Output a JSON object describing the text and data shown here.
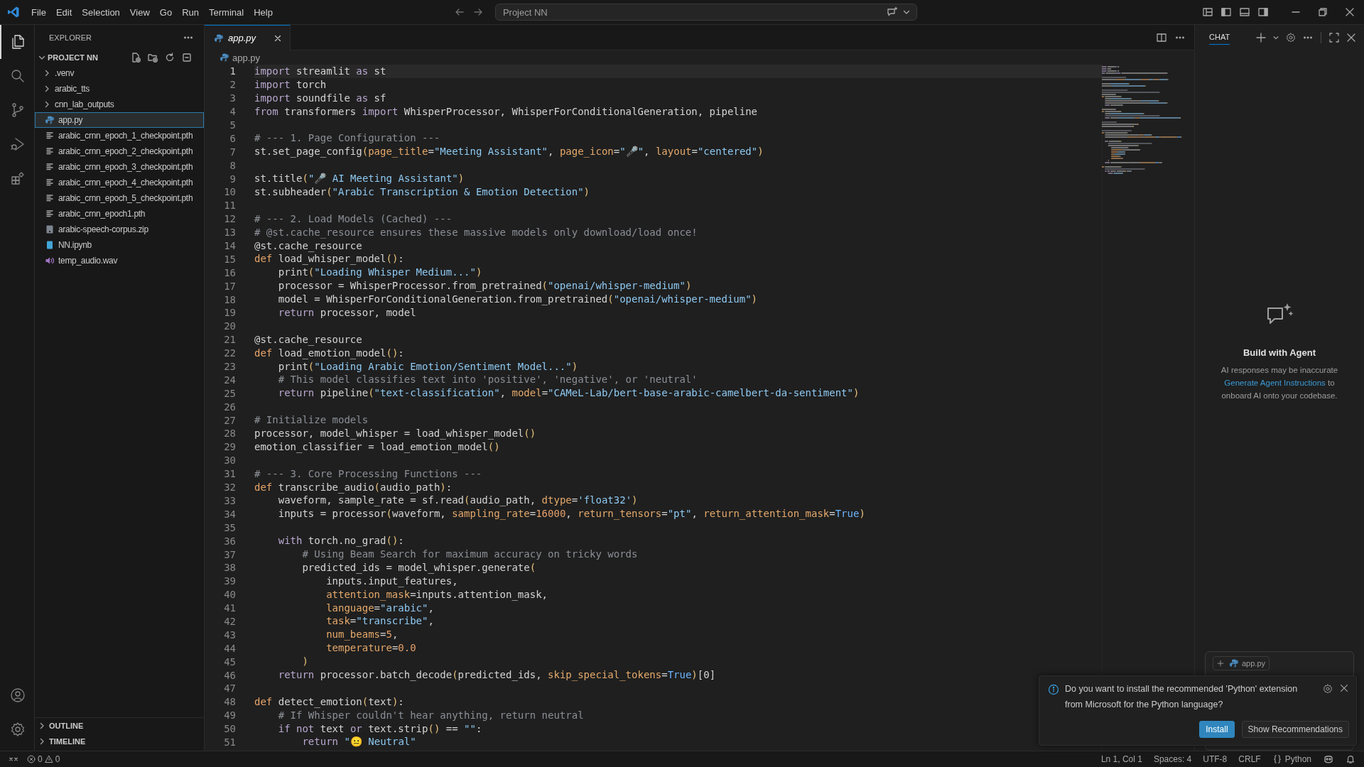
{
  "title_bar": {
    "menus": [
      "File",
      "Edit",
      "Selection",
      "View",
      "Go",
      "Run",
      "Terminal",
      "Help"
    ],
    "command_center": "Project NN"
  },
  "activity_bar": {
    "items": [
      {
        "kind": "files",
        "selected": true
      },
      {
        "kind": "search",
        "selected": false
      },
      {
        "kind": "branch",
        "selected": false
      },
      {
        "kind": "debug",
        "selected": false
      },
      {
        "kind": "extensions",
        "selected": false
      }
    ],
    "bottom": [
      {
        "kind": "account"
      },
      {
        "kind": "settings"
      }
    ]
  },
  "sidebar": {
    "title": "EXPLORER",
    "folder": {
      "label": "PROJECT NN",
      "expanded": true
    },
    "items": [
      {
        "label": ".venv",
        "kind": "folder",
        "expanded": false,
        "selected": false
      },
      {
        "label": "arabic_tts",
        "kind": "folder",
        "expanded": false,
        "selected": false
      },
      {
        "label": "cnn_lab_outputs",
        "kind": "folder",
        "expanded": false,
        "selected": false
      },
      {
        "label": "app.py",
        "kind": "python",
        "selected": true
      },
      {
        "label": "arabic_crnn_epoch_1_checkpoint.pth",
        "kind": "file",
        "selected": false
      },
      {
        "label": "arabic_crnn_epoch_2_checkpoint.pth",
        "kind": "file",
        "selected": false
      },
      {
        "label": "arabic_crnn_epoch_3_checkpoint.pth",
        "kind": "file",
        "selected": false
      },
      {
        "label": "arabic_crnn_epoch_4_checkpoint.pth",
        "kind": "file",
        "selected": false
      },
      {
        "label": "arabic_crnn_epoch_5_checkpoint.pth",
        "kind": "file",
        "selected": false
      },
      {
        "label": "arabic_crnn_epoch1.pth",
        "kind": "file",
        "selected": false
      },
      {
        "label": "arabic-speech-corpus.zip",
        "kind": "zip",
        "selected": false
      },
      {
        "label": "NN.ipynb",
        "kind": "notebook",
        "selected": false
      },
      {
        "label": "temp_audio.wav",
        "kind": "audio",
        "selected": false
      }
    ],
    "sections": [
      {
        "label": "OUTLINE",
        "expanded": false
      },
      {
        "label": "TIMELINE",
        "expanded": false
      }
    ]
  },
  "editor": {
    "tabs": [
      {
        "label": "app.py",
        "selected": true
      }
    ],
    "breadcrumb": "app.py",
    "lines": [
      {
        "n": "1",
        "current": true,
        "tokens": [
          {
            "kind": "k",
            "text": "import"
          },
          {
            "kind": "p",
            "text": " streamlit "
          },
          {
            "kind": "k",
            "text": "as"
          },
          {
            "kind": "p",
            "text": " st"
          }
        ]
      },
      {
        "n": "2",
        "current": false,
        "tokens": [
          {
            "kind": "k",
            "text": "import"
          },
          {
            "kind": "p",
            "text": " torch"
          }
        ]
      },
      {
        "n": "3",
        "current": false,
        "tokens": [
          {
            "kind": "k",
            "text": "import"
          },
          {
            "kind": "p",
            "text": " soundfile "
          },
          {
            "kind": "k",
            "text": "as"
          },
          {
            "kind": "p",
            "text": " sf"
          }
        ]
      },
      {
        "n": "4",
        "current": false,
        "tokens": [
          {
            "kind": "k",
            "text": "from"
          },
          {
            "kind": "p",
            "text": " transformers "
          },
          {
            "kind": "k",
            "text": "import"
          },
          {
            "kind": "p",
            "text": " WhisperProcessor, WhisperForConditionalGeneration, pipeline"
          }
        ]
      },
      {
        "n": "5",
        "current": false
      },
      {
        "n": "6",
        "current": false,
        "tokens": [
          {
            "kind": "c",
            "text": "# --- 1. Page Configuration ---"
          }
        ]
      },
      {
        "n": "7",
        "current": false,
        "tokens": [
          {
            "kind": "p",
            "text": "st.set_page_config"
          },
          {
            "kind": "b",
            "text": "("
          },
          {
            "kind": "a",
            "text": "page_title"
          },
          {
            "kind": "p",
            "text": "="
          },
          {
            "kind": "s",
            "text": "\"Meeting Assistant\""
          },
          {
            "kind": "p",
            "text": ", "
          },
          {
            "kind": "a",
            "text": "page_icon"
          },
          {
            "kind": "p",
            "text": "="
          },
          {
            "kind": "s",
            "text": "\"🎤\""
          },
          {
            "kind": "p",
            "text": ", "
          },
          {
            "kind": "a",
            "text": "layout"
          },
          {
            "kind": "p",
            "text": "="
          },
          {
            "kind": "s",
            "text": "\"centered\""
          },
          {
            "kind": "b",
            "text": ")"
          }
        ]
      },
      {
        "n": "8",
        "current": false
      },
      {
        "n": "9",
        "current": false,
        "tokens": [
          {
            "kind": "p",
            "text": "st.title"
          },
          {
            "kind": "b",
            "text": "("
          },
          {
            "kind": "s",
            "text": "\"🎤 AI Meeting Assistant\""
          },
          {
            "kind": "b",
            "text": ")"
          }
        ]
      },
      {
        "n": "10",
        "current": false,
        "tokens": [
          {
            "kind": "p",
            "text": "st.subheader"
          },
          {
            "kind": "b",
            "text": "("
          },
          {
            "kind": "s",
            "text": "\"Arabic Transcription & Emotion Detection\""
          },
          {
            "kind": "b",
            "text": ")"
          }
        ]
      },
      {
        "n": "11",
        "current": false
      },
      {
        "n": "12",
        "current": false,
        "tokens": [
          {
            "kind": "c",
            "text": "# --- 2. Load Models (Cached) ---"
          }
        ]
      },
      {
        "n": "13",
        "current": false,
        "tokens": [
          {
            "kind": "c",
            "text": "# @st.cache_resource ensures these massive models only download/load once!"
          }
        ]
      },
      {
        "n": "14",
        "current": false,
        "tokens": [
          {
            "kind": "p",
            "text": "@st.cache_resource"
          }
        ]
      },
      {
        "n": "15",
        "current": false,
        "tokens": [
          {
            "kind": "d",
            "text": "def"
          },
          {
            "kind": "p",
            "text": " load_whisper_model"
          },
          {
            "kind": "b",
            "text": "()"
          },
          {
            "kind": "p",
            "text": ":"
          }
        ]
      },
      {
        "n": "16",
        "current": false,
        "tokens": [
          {
            "kind": "p",
            "text": "    print"
          },
          {
            "kind": "b",
            "text": "("
          },
          {
            "kind": "s",
            "text": "\"Loading Whisper Medium...\""
          },
          {
            "kind": "b",
            "text": ")"
          }
        ]
      },
      {
        "n": "17",
        "current": false,
        "tokens": [
          {
            "kind": "p",
            "text": "    processor = WhisperProcessor.from_pretrained"
          },
          {
            "kind": "b",
            "text": "("
          },
          {
            "kind": "s",
            "text": "\"openai/whisper-medium\""
          },
          {
            "kind": "b",
            "text": ")"
          }
        ]
      },
      {
        "n": "18",
        "current": false,
        "tokens": [
          {
            "kind": "p",
            "text": "    model = WhisperForConditionalGeneration.from_pretrained"
          },
          {
            "kind": "b",
            "text": "("
          },
          {
            "kind": "s",
            "text": "\"openai/whisper-medium\""
          },
          {
            "kind": "b",
            "text": ")"
          }
        ]
      },
      {
        "n": "19",
        "current": false,
        "tokens": [
          {
            "kind": "k",
            "text": "    return"
          },
          {
            "kind": "p",
            "text": " processor, model"
          }
        ]
      },
      {
        "n": "20",
        "current": false
      },
      {
        "n": "21",
        "current": false,
        "tokens": [
          {
            "kind": "p",
            "text": "@st.cache_resource"
          }
        ]
      },
      {
        "n": "22",
        "current": false,
        "tokens": [
          {
            "kind": "d",
            "text": "def"
          },
          {
            "kind": "p",
            "text": " load_emotion_model"
          },
          {
            "kind": "b",
            "text": "()"
          },
          {
            "kind": "p",
            "text": ":"
          }
        ]
      },
      {
        "n": "23",
        "current": false,
        "tokens": [
          {
            "kind": "p",
            "text": "    print"
          },
          {
            "kind": "b",
            "text": "("
          },
          {
            "kind": "s",
            "text": "\"Loading Arabic Emotion/Sentiment Model...\""
          },
          {
            "kind": "b",
            "text": ")"
          }
        ]
      },
      {
        "n": "24",
        "current": false,
        "tokens": [
          {
            "kind": "c",
            "text": "    # This model classifies text into 'positive', 'negative', or 'neutral'"
          }
        ]
      },
      {
        "n": "25",
        "current": false,
        "tokens": [
          {
            "kind": "k",
            "text": "    return"
          },
          {
            "kind": "p",
            "text": " pipeline"
          },
          {
            "kind": "b",
            "text": "("
          },
          {
            "kind": "s",
            "text": "\"text-classification\""
          },
          {
            "kind": "p",
            "text": ", "
          },
          {
            "kind": "a",
            "text": "model"
          },
          {
            "kind": "p",
            "text": "="
          },
          {
            "kind": "s",
            "text": "\"CAMeL-Lab/bert-base-arabic-camelbert-da-sentiment\""
          },
          {
            "kind": "b",
            "text": ")"
          }
        ]
      },
      {
        "n": "26",
        "current": false
      },
      {
        "n": "27",
        "current": false,
        "tokens": [
          {
            "kind": "c",
            "text": "# Initialize models"
          }
        ]
      },
      {
        "n": "28",
        "current": false,
        "tokens": [
          {
            "kind": "p",
            "text": "processor, model_whisper = load_whisper_model"
          },
          {
            "kind": "b",
            "text": "()"
          }
        ]
      },
      {
        "n": "29",
        "current": false,
        "tokens": [
          {
            "kind": "p",
            "text": "emotion_classifier = load_emotion_model"
          },
          {
            "kind": "b",
            "text": "()"
          }
        ]
      },
      {
        "n": "30",
        "current": false
      },
      {
        "n": "31",
        "current": false,
        "tokens": [
          {
            "kind": "c",
            "text": "# --- 3. Core Processing Functions ---"
          }
        ]
      },
      {
        "n": "32",
        "current": false,
        "tokens": [
          {
            "kind": "d",
            "text": "def"
          },
          {
            "kind": "p",
            "text": " transcribe_audio"
          },
          {
            "kind": "b",
            "text": "("
          },
          {
            "kind": "p",
            "text": "audio_path"
          },
          {
            "kind": "b",
            "text": ")"
          },
          {
            "kind": "p",
            "text": ":"
          }
        ]
      },
      {
        "n": "33",
        "current": false,
        "tokens": [
          {
            "kind": "p",
            "text": "    waveform, sample_rate = sf.read"
          },
          {
            "kind": "b",
            "text": "("
          },
          {
            "kind": "p",
            "text": "audio_path, "
          },
          {
            "kind": "a",
            "text": "dtype"
          },
          {
            "kind": "p",
            "text": "="
          },
          {
            "kind": "s",
            "text": "'float32'"
          },
          {
            "kind": "b",
            "text": ")"
          }
        ]
      },
      {
        "n": "34",
        "current": false,
        "tokens": [
          {
            "kind": "p",
            "text": "    inputs = processor"
          },
          {
            "kind": "b",
            "text": "("
          },
          {
            "kind": "p",
            "text": "waveform, "
          },
          {
            "kind": "a",
            "text": "sampling_rate"
          },
          {
            "kind": "p",
            "text": "="
          },
          {
            "kind": "n",
            "text": "16000"
          },
          {
            "kind": "p",
            "text": ", "
          },
          {
            "kind": "a",
            "text": "return_tensors"
          },
          {
            "kind": "p",
            "text": "="
          },
          {
            "kind": "s",
            "text": "\"pt\""
          },
          {
            "kind": "p",
            "text": ", "
          },
          {
            "kind": "a",
            "text": "return_attention_mask"
          },
          {
            "kind": "p",
            "text": "="
          },
          {
            "kind": "t",
            "text": "True"
          },
          {
            "kind": "b",
            "text": ")"
          }
        ]
      },
      {
        "n": "35",
        "current": false
      },
      {
        "n": "36",
        "current": false,
        "tokens": [
          {
            "kind": "k",
            "text": "    with"
          },
          {
            "kind": "p",
            "text": " torch.no_grad"
          },
          {
            "kind": "b",
            "text": "()"
          },
          {
            "kind": "p",
            "text": ":"
          }
        ]
      },
      {
        "n": "37",
        "current": false,
        "tokens": [
          {
            "kind": "c",
            "text": "        # Using Beam Search for maximum accuracy on tricky words"
          }
        ]
      },
      {
        "n": "38",
        "current": false,
        "tokens": [
          {
            "kind": "p",
            "text": "        predicted_ids = model_whisper.generate"
          },
          {
            "kind": "b",
            "text": "("
          }
        ]
      },
      {
        "n": "39",
        "current": false,
        "tokens": [
          {
            "kind": "p",
            "text": "            inputs.input_features,"
          }
        ]
      },
      {
        "n": "40",
        "current": false,
        "tokens": [
          {
            "kind": "a",
            "text": "            attention_mask"
          },
          {
            "kind": "p",
            "text": "=inputs.attention_mask,"
          }
        ]
      },
      {
        "n": "41",
        "current": false,
        "tokens": [
          {
            "kind": "a",
            "text": "            language"
          },
          {
            "kind": "p",
            "text": "="
          },
          {
            "kind": "s",
            "text": "\"arabic\""
          },
          {
            "kind": "p",
            "text": ","
          }
        ]
      },
      {
        "n": "42",
        "current": false,
        "tokens": [
          {
            "kind": "a",
            "text": "            task"
          },
          {
            "kind": "p",
            "text": "="
          },
          {
            "kind": "s",
            "text": "\"transcribe\""
          },
          {
            "kind": "p",
            "text": ","
          }
        ]
      },
      {
        "n": "43",
        "current": false,
        "tokens": [
          {
            "kind": "a",
            "text": "            num_beams"
          },
          {
            "kind": "p",
            "text": "="
          },
          {
            "kind": "n",
            "text": "5"
          },
          {
            "kind": "p",
            "text": ","
          }
        ]
      },
      {
        "n": "44",
        "current": false,
        "tokens": [
          {
            "kind": "a",
            "text": "            temperature"
          },
          {
            "kind": "p",
            "text": "="
          },
          {
            "kind": "n",
            "text": "0.0"
          }
        ]
      },
      {
        "n": "45",
        "current": false,
        "tokens": [
          {
            "kind": "b",
            "text": "        )"
          }
        ]
      },
      {
        "n": "46",
        "current": false,
        "tokens": [
          {
            "kind": "k",
            "text": "    return"
          },
          {
            "kind": "p",
            "text": " processor.batch_decode"
          },
          {
            "kind": "b",
            "text": "("
          },
          {
            "kind": "p",
            "text": "predicted_ids, "
          },
          {
            "kind": "a",
            "text": "skip_special_tokens"
          },
          {
            "kind": "p",
            "text": "="
          },
          {
            "kind": "t",
            "text": "True"
          },
          {
            "kind": "b",
            "text": ")"
          },
          {
            "kind": "p",
            "text": "[0]"
          }
        ]
      },
      {
        "n": "47",
        "current": false
      },
      {
        "n": "48",
        "current": false,
        "tokens": [
          {
            "kind": "d",
            "text": "def"
          },
          {
            "kind": "p",
            "text": " detect_emotion"
          },
          {
            "kind": "b",
            "text": "("
          },
          {
            "kind": "p",
            "text": "text"
          },
          {
            "kind": "b",
            "text": ")"
          },
          {
            "kind": "p",
            "text": ":"
          }
        ]
      },
      {
        "n": "49",
        "current": false,
        "tokens": [
          {
            "kind": "c",
            "text": "    # If Whisper couldn't hear anything, return neutral"
          }
        ]
      },
      {
        "n": "50",
        "current": false,
        "tokens": [
          {
            "kind": "k",
            "text": "    if"
          },
          {
            "kind": "k",
            "text": " not"
          },
          {
            "kind": "p",
            "text": " text "
          },
          {
            "kind": "k",
            "text": "or"
          },
          {
            "kind": "p",
            "text": " text.strip"
          },
          {
            "kind": "b",
            "text": "()"
          },
          {
            "kind": "p",
            "text": " == "
          },
          {
            "kind": "s",
            "text": "\"\""
          },
          {
            "kind": "p",
            "text": ":"
          }
        ]
      },
      {
        "n": "51",
        "current": false,
        "tokens": [
          {
            "kind": "k",
            "text": "        return"
          },
          {
            "kind": "s",
            "text": " \"😐 Neutral\""
          }
        ]
      }
    ]
  },
  "chat": {
    "title": "CHAT",
    "heading": "Build with Agent",
    "note": "AI responses may be inaccurate",
    "link": "Generate Agent Instructions",
    "link_rest": " to onboard AI onto your codebase.",
    "attachment": "app.py"
  },
  "notification": {
    "message": "Do you want to install the recommended 'Python' extension from Microsoft for the Python language?",
    "buttons": [
      {
        "label": "Install",
        "primary": true
      },
      {
        "label": "Show Recommendations",
        "primary": false
      }
    ]
  },
  "status_bar": {
    "errors": "0",
    "warnings": "0",
    "items": [
      "Ln 1, Col 1",
      "Spaces: 4",
      "UTF-8",
      "CRLF"
    ],
    "language": "Python"
  }
}
